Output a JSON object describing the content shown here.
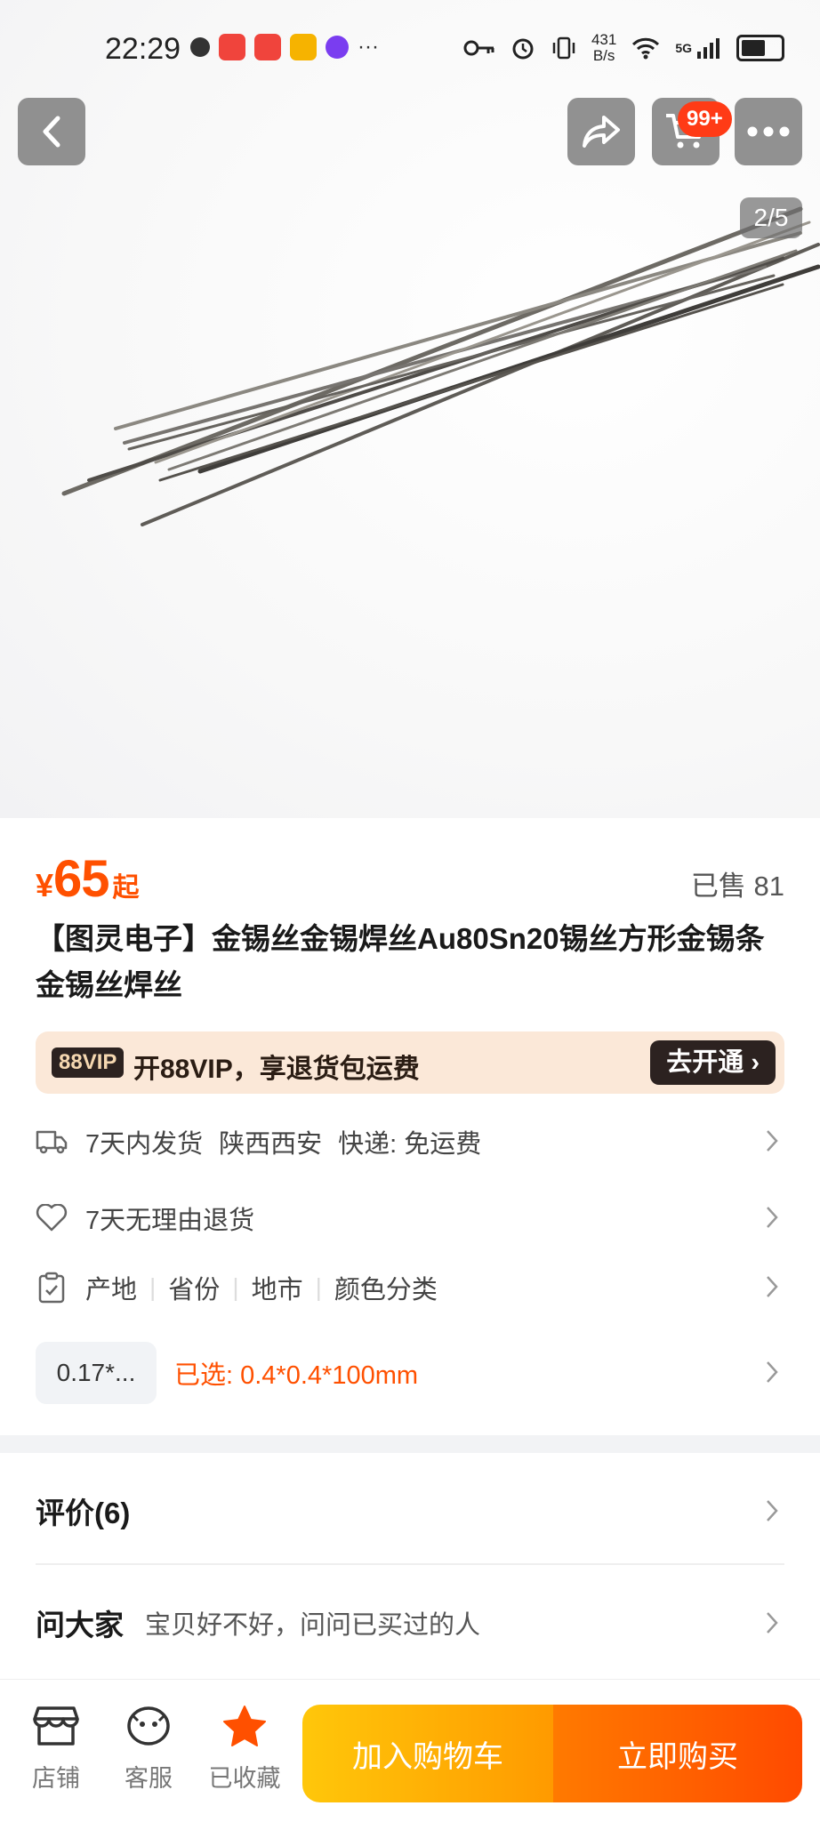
{
  "status": {
    "time": "22:29",
    "net_speed": "431",
    "net_unit": "B/s",
    "more": "···",
    "net_type": "5G"
  },
  "gallery": {
    "counter": "2/5",
    "cart_badge": "99+"
  },
  "product": {
    "currency": "¥",
    "price": "65",
    "price_suffix": "起",
    "sold": "已售 81",
    "title": "【图灵电子】金锡丝金锡焊丝Au80Sn20锡丝方形金锡条金锡丝焊丝"
  },
  "vip": {
    "badge": "88VIP",
    "text": "开88VIP，享退货包运费",
    "button": "去开通 ›"
  },
  "shipping": {
    "items": [
      "7天内发货",
      "陕西西安",
      "快递: 免运费"
    ]
  },
  "returns": {
    "text": "7天无理由退货"
  },
  "params": {
    "items": [
      "产地",
      "省份",
      "地市",
      "颜色分类"
    ]
  },
  "spec": {
    "option": "0.17*...",
    "selected": "已选: 0.4*0.4*100mm"
  },
  "reviews": {
    "title": "评价(6)"
  },
  "qa": {
    "title": "问大家",
    "subtitle": "宝贝好不好，问问已买过的人"
  },
  "bottom": {
    "shop": "店铺",
    "service": "客服",
    "favorited": "已收藏",
    "add_cart": "加入购物车",
    "buy_now": "立即购买"
  },
  "colors": {
    "accent": "#ff5000",
    "vip_bg": "#fbe8d8",
    "cart_btn": "#ffb300",
    "buy_btn": "#ff5a00"
  }
}
